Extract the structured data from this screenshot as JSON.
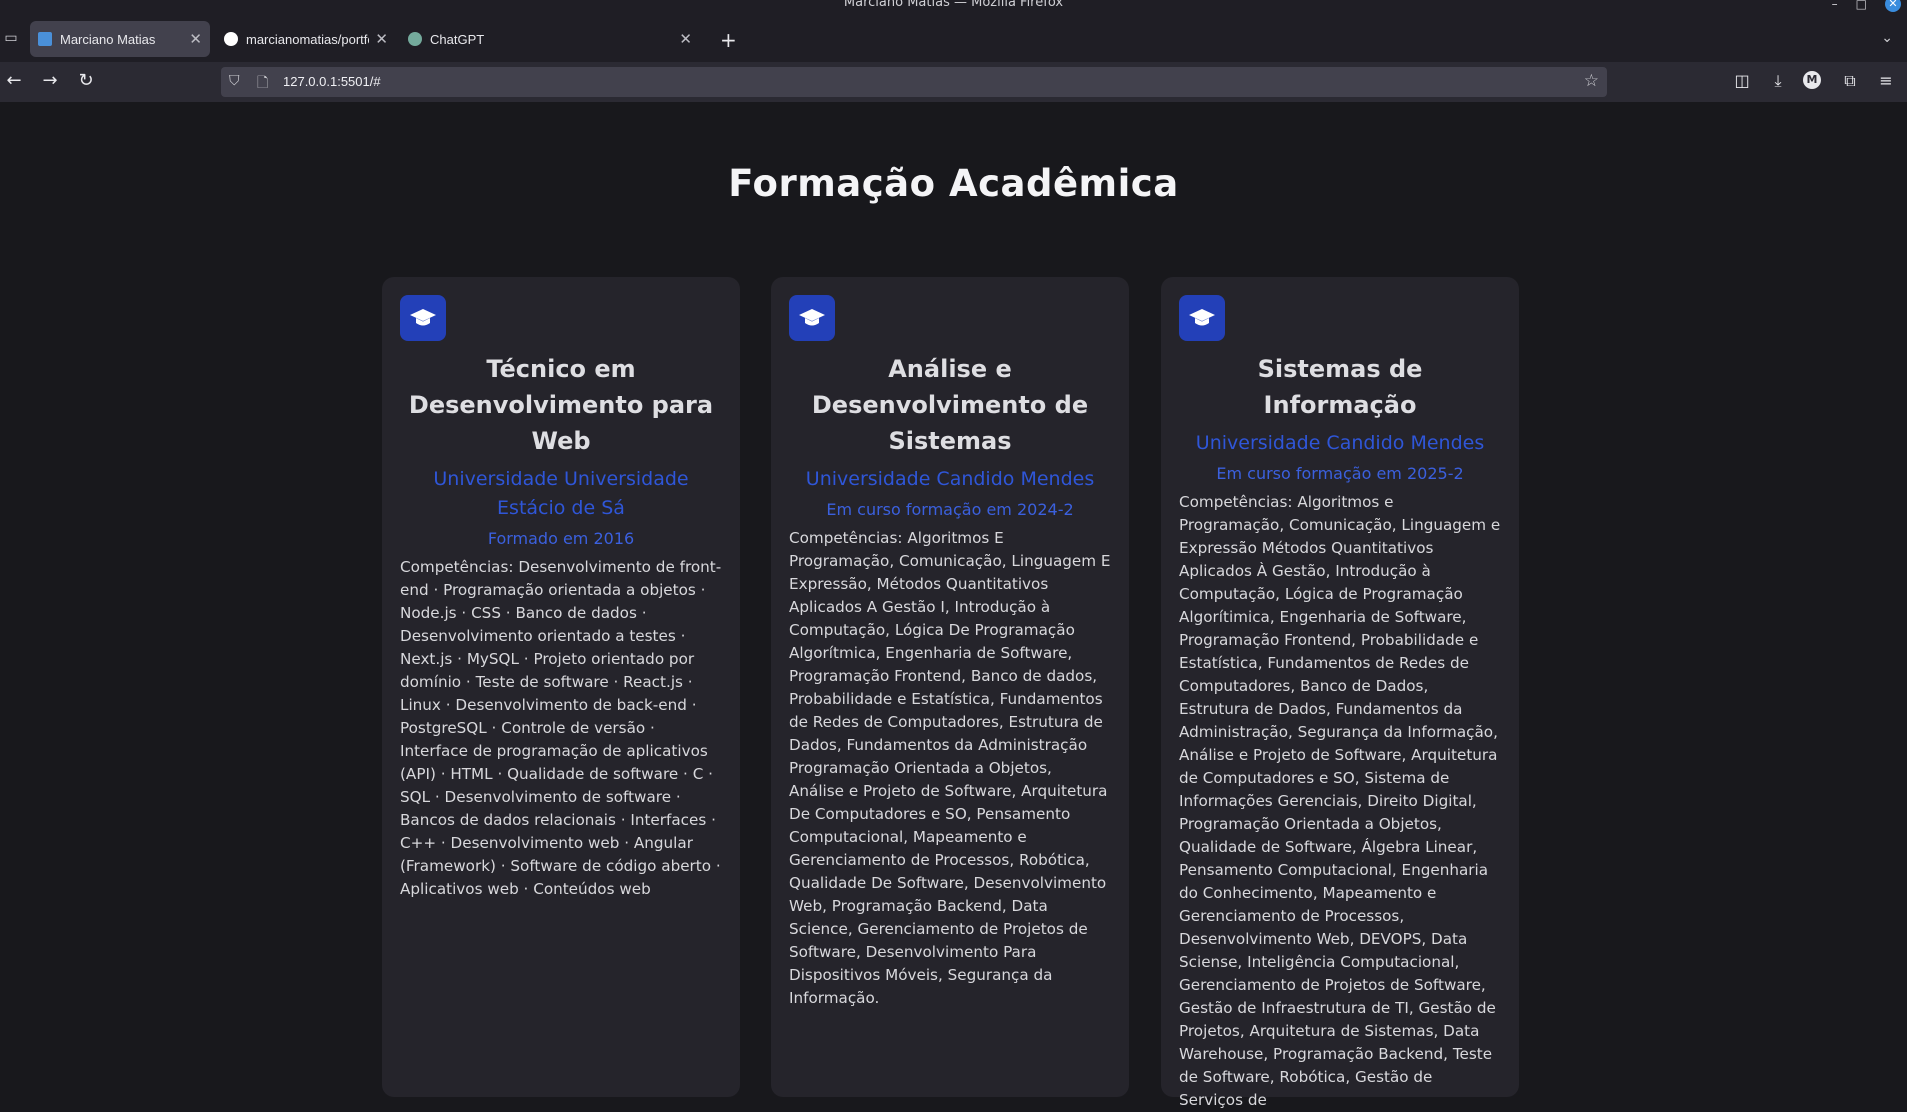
{
  "browser": {
    "window_title": "Marciano Matias — Mozilla Firefox",
    "tabs": [
      {
        "label": "Marciano Matias",
        "favicon": "monitor-icon",
        "favicon_color": "#4a90d9"
      },
      {
        "label": "marcianomatias/portfolio-",
        "favicon": "github-icon",
        "favicon_color": "#ffffff"
      },
      {
        "label": "ChatGPT",
        "favicon": "chatgpt-icon",
        "favicon_color": "#74aa9c"
      }
    ],
    "url": "127.0.0.1:5501/#",
    "account_initial": "M"
  },
  "page": {
    "section_title": "Formação Acadêmica",
    "accent_color": "#2f56d8",
    "cards": [
      {
        "icon": "graduation-cap-icon",
        "title": "Técnico em Desenvolvimento para Web",
        "school": "Universidade Universidade Estácio de Sá",
        "period": "Formado em 2016",
        "skills": "Competências: Desenvolvimento de front-end · Programação orientada a objetos · Node.js · CSS · Banco de dados · Desenvolvimento orientado a testes · Next.js · MySQL · Projeto orientado por domínio · Teste de software · React.js · Linux · Desenvolvimento de back-end · PostgreSQL · Controle de versão · Interface de programação de aplicativos (API) · HTML · Qualidade de software · C · SQL · Desenvolvimento de software · Bancos de dados relacionais · Interfaces · C++ · Desenvolvimento web · Angular (Framework) · Software de código aberto · Aplicativos web · Conteúdos web"
      },
      {
        "icon": "graduation-cap-icon",
        "title": "Análise e Desenvolvimento de Sistemas",
        "school": "Universidade Candido Mendes",
        "period": "Em curso formação em 2024-2",
        "skills": "Competências: Algoritmos E Programação, Comunicação, Linguagem E Expressão, Métodos Quantitativos Aplicados A Gestão I, Introdução à Computação, Lógica De Programação Algorítmica, Engenharia de Software, Programação Frontend, Banco de dados, Probabilidade e Estatística, Fundamentos de Redes de Computadores, Estrutura de Dados, Fundamentos da Administração Programação Orientada a Objetos, Análise e Projeto de Software, Arquitetura De Computadores e SO, Pensamento Computacional, Mapeamento e Gerenciamento de Processos, Robótica, Qualidade De Software, Desenvolvimento Web, Programação Backend, Data Science, Gerenciamento de Projetos de Software, Desenvolvimento Para Dispositivos Móveis, Segurança da Informação."
      },
      {
        "icon": "graduation-cap-icon",
        "title": "Sistemas de Informação",
        "school": "Universidade Candido Mendes",
        "period": "Em curso formação em 2025-2",
        "skills": "Competências: Algoritmos e Programação, Comunicação, Linguagem e Expressão Métodos Quantitativos Aplicados À Gestão, Introdução à Computação, Lógica de Programação Algorítimica, Engenharia de Software, Programação Frontend, Probabilidade e Estatística, Fundamentos de Redes de Computadores, Banco de Dados, Estrutura de Dados, Fundamentos da Administração, Segurança da Informação, Análise e Projeto de Software, Arquitetura de Computadores e SO, Sistema de Informações Gerenciais, Direito Digital, Programação Orientada a Objetos, Qualidade de Software, Álgebra Linear, Pensamento Computacional, Engenharia do Conhecimento, Mapeamento e Gerenciamento de Processos, Desenvolvimento Web, DEVOPS, Data Sciense, Inteligência Computacional, Gerenciamento de Projetos de Software, Gestão de Infraestrutura de TI, Gestão de Projetos, Arquitetura de Sistemas, Data Warehouse, Programação Backend, Teste de Software, Robótica, Gestão de Serviços de"
      }
    ]
  }
}
